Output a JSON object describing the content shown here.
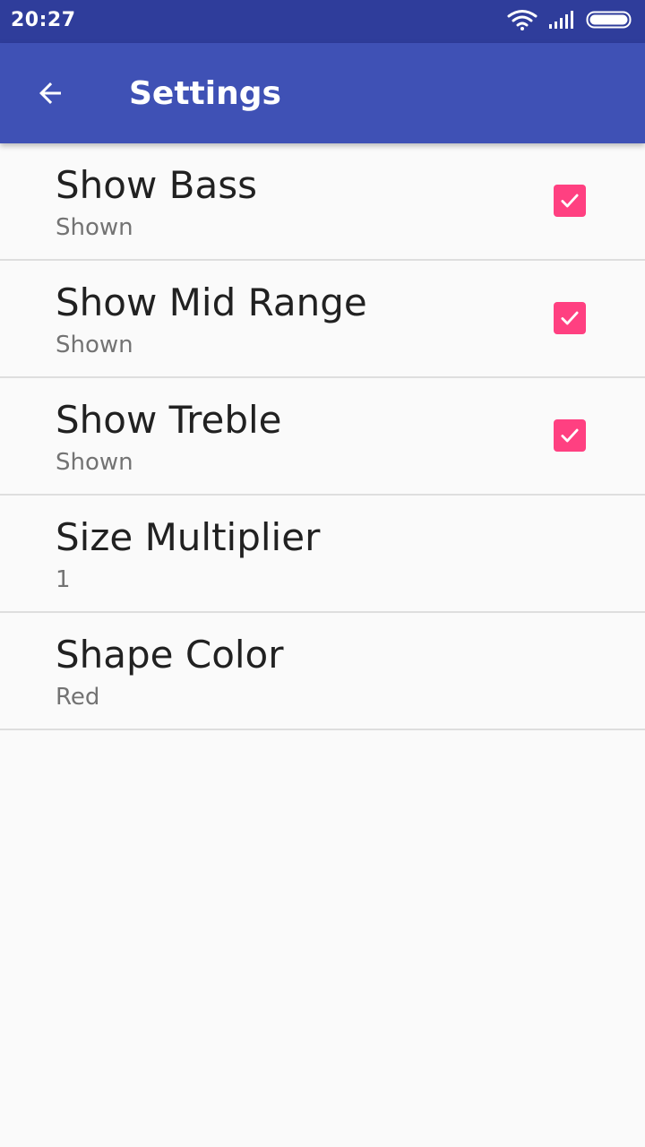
{
  "status_bar": {
    "time": "20:27",
    "icons": [
      "wifi-icon",
      "signal-icon",
      "battery-icon"
    ]
  },
  "app_bar": {
    "title": "Settings",
    "back_icon": "arrow-back-icon",
    "background": "#3f51b5"
  },
  "colors": {
    "status_bar": "#2f3d9b",
    "accent": "#ff4081"
  },
  "preferences": [
    {
      "title": "Show Bass",
      "summary": "Shown",
      "checked": true
    },
    {
      "title": "Show Mid Range",
      "summary": "Shown",
      "checked": true
    },
    {
      "title": "Show Treble",
      "summary": "Shown",
      "checked": true
    },
    {
      "title": "Size Multiplier",
      "summary": "1"
    },
    {
      "title": "Shape Color",
      "summary": "Red"
    }
  ]
}
